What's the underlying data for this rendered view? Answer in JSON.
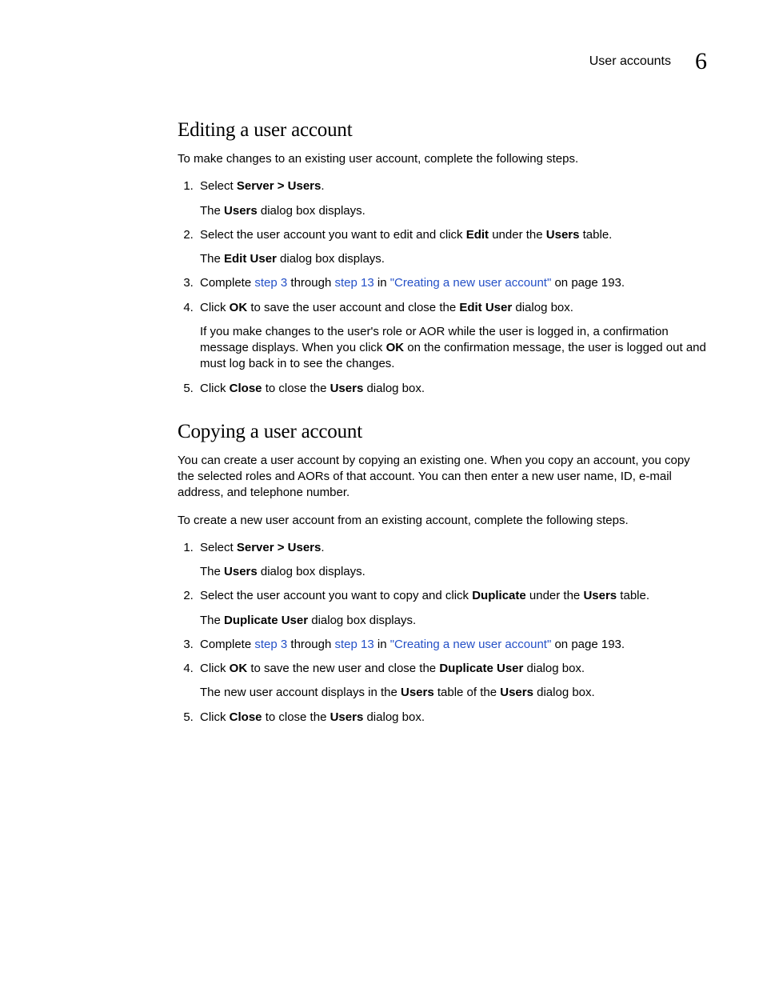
{
  "header": {
    "title": "User accounts",
    "chapter": "6"
  },
  "editing": {
    "title": "Editing a user account",
    "intro": "To make changes to an existing user account, complete the following steps.",
    "step1_a": "Select ",
    "step1_b": "Server > Users",
    "step1_c": ".",
    "step1_sub_a": "The ",
    "step1_sub_b": "Users",
    "step1_sub_c": " dialog box displays.",
    "step2_a": "Select the user account you want to edit and click ",
    "step2_b": "Edit",
    "step2_c": " under the ",
    "step2_d": "Users",
    "step2_e": " table.",
    "step2_sub_a": "The ",
    "step2_sub_b": "Edit User",
    "step2_sub_c": " dialog box displays.",
    "step3_a": "Complete ",
    "step3_link1": "step 3",
    "step3_b": " through ",
    "step3_link2": "step 13",
    "step3_c": " in ",
    "step3_link3": "\"Creating a new user account\"",
    "step3_d": " on page 193.",
    "step4_a": "Click ",
    "step4_b": "OK",
    "step4_c": " to save the user account and close the ",
    "step4_d": "Edit User",
    "step4_e": " dialog box.",
    "step4_sub_a": "If you make changes to the user's role or AOR while the user is logged in, a confirmation message displays. When you click ",
    "step4_sub_b": "OK",
    "step4_sub_c": " on the confirmation message, the user is logged out and must log back in to see the changes.",
    "step5_a": "Click ",
    "step5_b": "Close",
    "step5_c": " to close the ",
    "step5_d": "Users",
    "step5_e": " dialog box."
  },
  "copying": {
    "title": "Copying a user account",
    "intro1": "You can create a user account by copying an existing one. When you copy an account, you copy the selected roles and AORs of that account. You can then enter a new user name, ID, e-mail address, and telephone number.",
    "intro2": "To create a new user account from an existing account, complete the following steps.",
    "step1_a": "Select ",
    "step1_b": "Server > Users",
    "step1_c": ".",
    "step1_sub_a": "The ",
    "step1_sub_b": "Users",
    "step1_sub_c": " dialog box displays.",
    "step2_a": "Select the user account you want to copy and click ",
    "step2_b": "Duplicate",
    "step2_c": " under the ",
    "step2_d": "Users",
    "step2_e": " table.",
    "step2_sub_a": "The ",
    "step2_sub_b": "Duplicate User",
    "step2_sub_c": " dialog box displays.",
    "step3_a": "Complete ",
    "step3_link1": "step 3",
    "step3_b": " through ",
    "step3_link2": "step 13",
    "step3_c": " in ",
    "step3_link3": "\"Creating a new user account\"",
    "step3_d": " on page 193.",
    "step4_a": "Click ",
    "step4_b": "OK",
    "step4_c": " to save the new user and close the ",
    "step4_d": "Duplicate User",
    "step4_e": " dialog box.",
    "step4_sub_a": "The new user account displays in the ",
    "step4_sub_b": "Users",
    "step4_sub_c": " table of the ",
    "step4_sub_d": "Users",
    "step4_sub_e": " dialog box.",
    "step5_a": "Click ",
    "step5_b": "Close",
    "step5_c": " to close the ",
    "step5_d": "Users",
    "step5_e": " dialog box."
  }
}
